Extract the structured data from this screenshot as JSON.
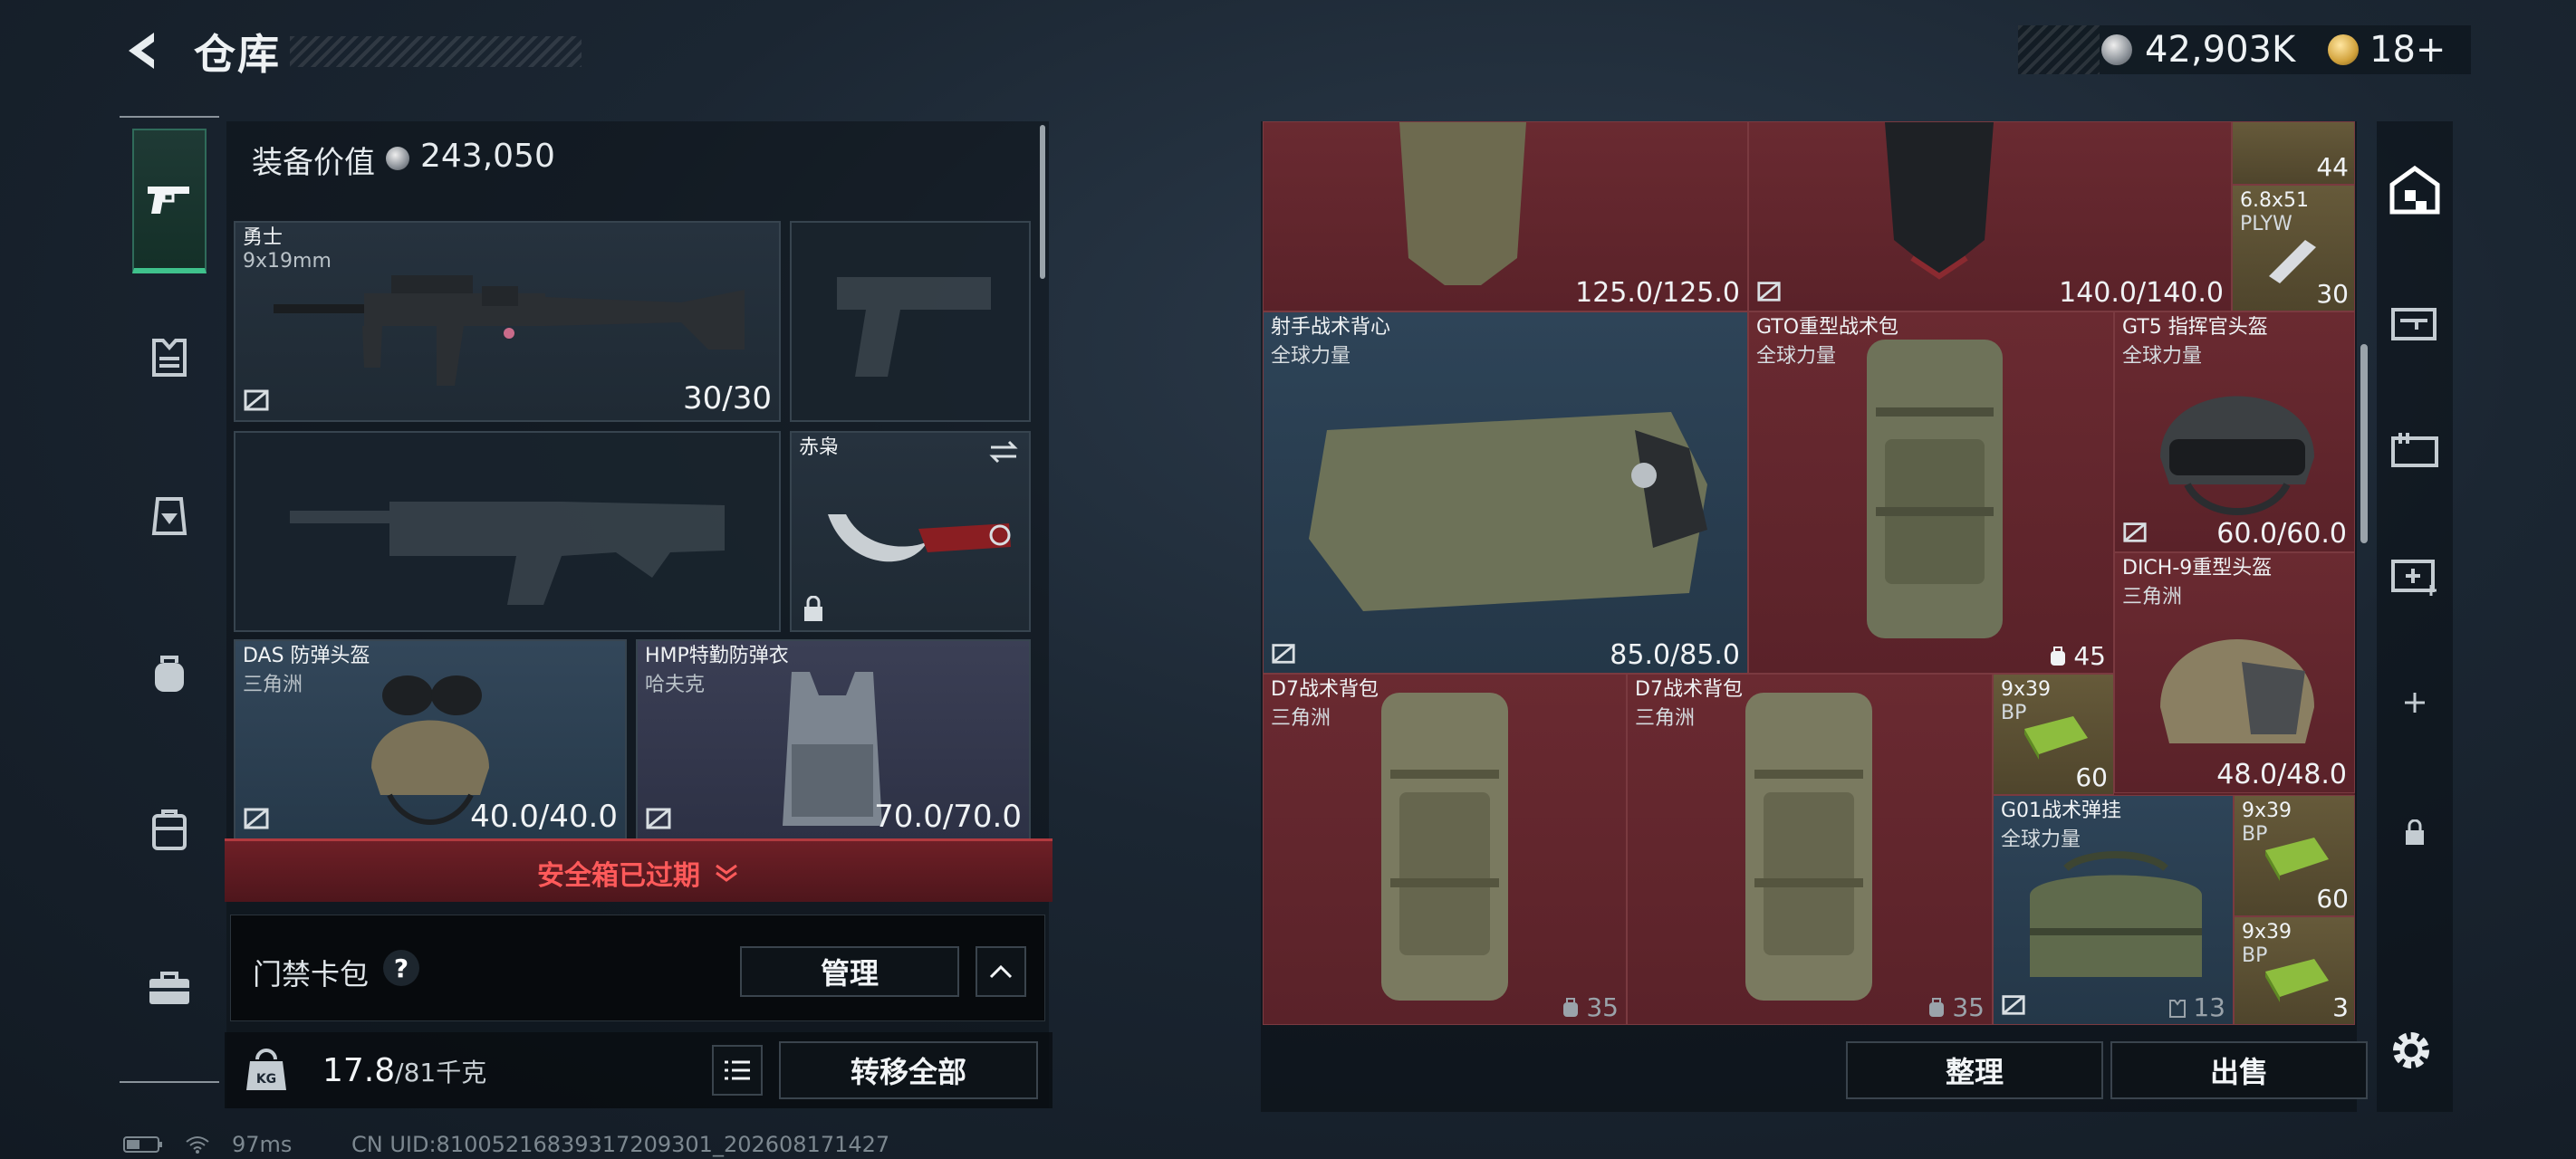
{
  "header": {
    "title": "仓库",
    "silver": "42,903K",
    "gold": "18+"
  },
  "left_rail": {
    "items": [
      "weapons",
      "armor",
      "backpack",
      "rig",
      "case",
      "toolbox"
    ]
  },
  "equipment": {
    "value_label": "装备价值",
    "value": "243,050",
    "primary_weapon": {
      "name": "勇士",
      "caliber": "9x19mm",
      "ammo": "30/30"
    },
    "melee": {
      "name": "赤枭"
    },
    "helmet": {
      "name": "DAS 防弹头盔",
      "origin": "三角洲",
      "durability": "40.0/40.0"
    },
    "armor": {
      "name": "HMP特勤防弹衣",
      "origin": "哈夫克",
      "durability": "70.0/70.0"
    },
    "safebox_status": "安全箱已过期",
    "keycard_label": "门禁卡包",
    "help": "?",
    "manage_label": "管理",
    "weight": "17.8",
    "weight_max": "/81千克",
    "transfer_label": "转移全部"
  },
  "storage": {
    "top_left_val": "125.0/125.0",
    "top_mid_val": "140.0/140.0",
    "top_ammo_count": "44",
    "ammo_68": {
      "name": "6.8x51",
      "sub": "PLYW",
      "count": "30"
    },
    "vest": {
      "name": "射手战术背心",
      "origin": "全球力量",
      "durability": "85.0/85.0"
    },
    "gto_pack": {
      "name": "GTO重型战术包",
      "origin": "全球力量",
      "capacity": "45"
    },
    "gt5_helmet": {
      "name": "GT5 指挥官头盔",
      "origin": "全球力量",
      "durability": "60.0/60.0"
    },
    "dich_helmet": {
      "name": "DICH-9重型头盔",
      "origin": "三角洲",
      "durability": "48.0/48.0"
    },
    "d7_pack_1": {
      "name": "D7战术背包",
      "origin": "三角洲",
      "capacity": "35"
    },
    "d7_pack_2": {
      "name": "D7战术背包",
      "origin": "三角洲",
      "capacity": "35"
    },
    "ammo_939_a": {
      "name": "9x39",
      "sub": "BP",
      "count": "60"
    },
    "g01_rig": {
      "name": "G01战术弹挂",
      "origin": "全球力量",
      "capacity": "13"
    },
    "ammo_939_b": {
      "name": "9x39",
      "sub": "BP",
      "count": "60"
    },
    "ammo_939_c": {
      "name": "9x39",
      "sub": "BP",
      "count": "3"
    },
    "sort_label": "整理",
    "sell_label": "出售"
  },
  "status": {
    "ping": "97ms",
    "uid": "CN UID:81005216839317209301_202608171427"
  },
  "colors": {
    "accent_green": "#3fc28c",
    "alert_red": "#ff5a5a",
    "tier_red": "#5a2229",
    "tier_blue": "#2e4458"
  }
}
